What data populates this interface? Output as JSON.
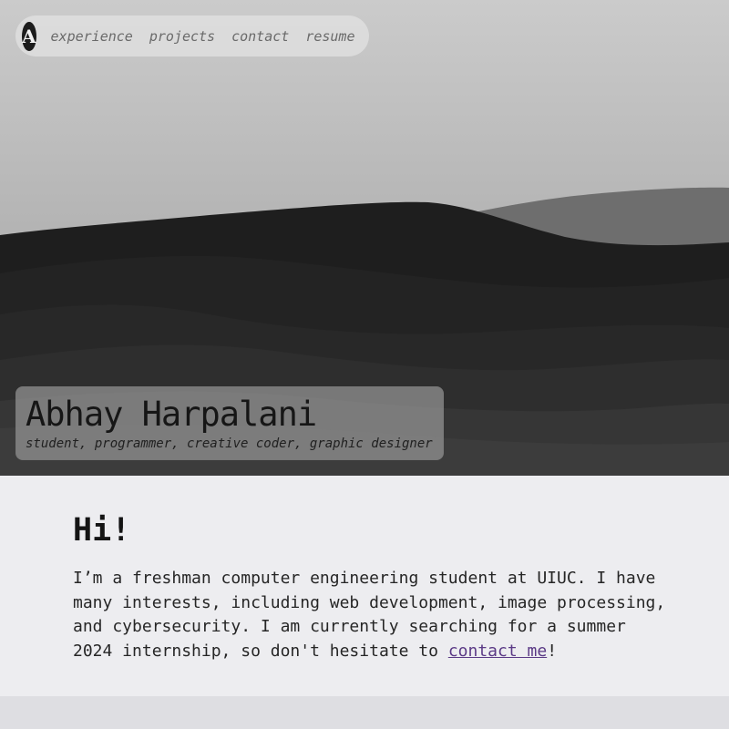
{
  "nav": {
    "logo_letter": "A",
    "links": [
      "experience",
      "projects",
      "contact",
      "resume"
    ]
  },
  "hero": {
    "name": "Abhay Harpalani",
    "tagline": "student, programmer, creative coder, graphic designer"
  },
  "intro": {
    "heading": "Hi!",
    "bio_before": "I’m a freshman computer engineering student at UIUC. I have many interests, including web development, image processing, and cybersecurity. I am currently searching for a summer 2024 internship, so don't hesitate to ",
    "contact_link": "contact me",
    "bio_after": "!"
  },
  "colors": {
    "link": "#5b3a86",
    "page_bg": "#ededf0",
    "nav_bg": "#e1e1e1"
  }
}
